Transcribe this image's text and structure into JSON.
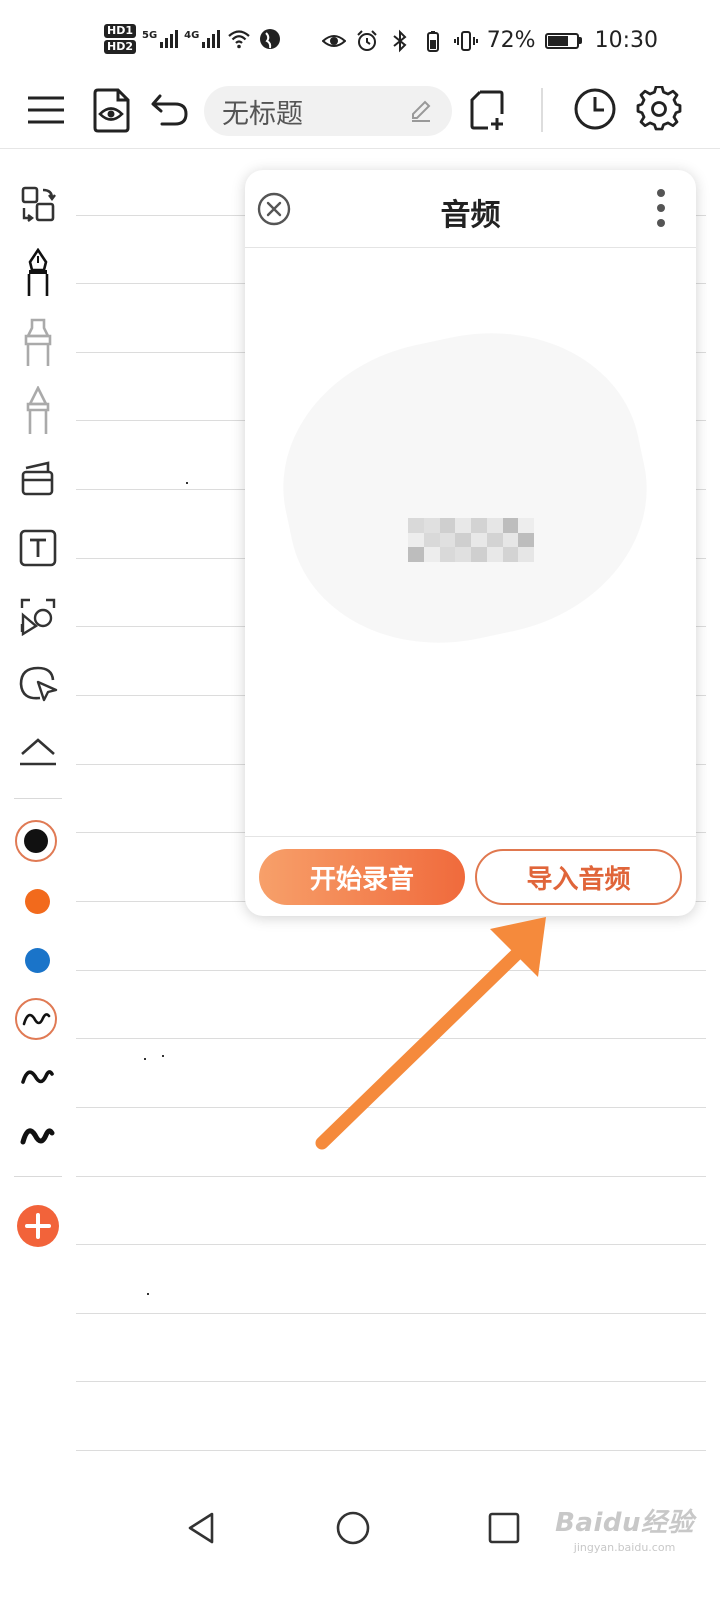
{
  "status_bar": {
    "hd1": "HD1",
    "hd2": "HD2",
    "net1": "5G",
    "net2": "4G",
    "battery_percent": "72%",
    "battery_level": 0.72,
    "time": "10:30"
  },
  "toolbar": {
    "title": "无标题",
    "icons": [
      "menu-icon",
      "preview-doc-icon",
      "undo-icon",
      "edit-pencil-icon",
      "new-page-icon",
      "history-clock-icon",
      "settings-gear-icon"
    ]
  },
  "tools": {
    "icons": [
      "layout-switch-icon",
      "fountain-pen-icon",
      "marker-icon",
      "pencil-icon",
      "eraser-icon",
      "text-box-icon",
      "lasso-shape-icon",
      "lasso-select-icon",
      "collapse-icon"
    ],
    "colors": [
      "#111111",
      "#f26a1c",
      "#1a74c9"
    ],
    "selected_color": "#111111",
    "accent": "#e07a54",
    "add_color": "#f2633a"
  },
  "popup": {
    "title": "音频",
    "record_button": "开始录音",
    "import_button": "导入音频"
  },
  "watermark": {
    "brand": "Baidu经验",
    "url": "jingyan.baidu.com"
  },
  "annotation": {
    "arrow_color": "#f58a3c"
  }
}
